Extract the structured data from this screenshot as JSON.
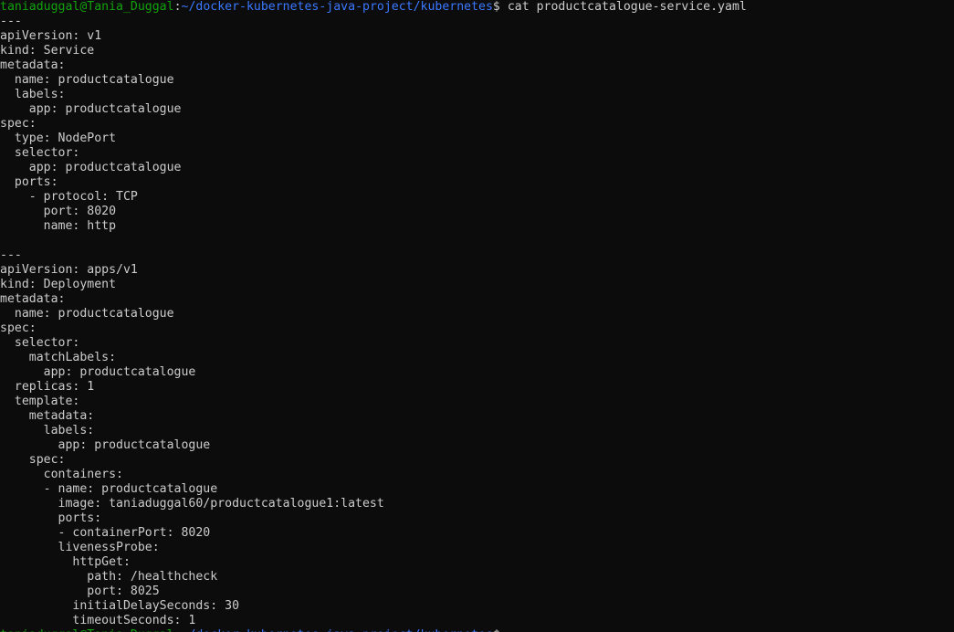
{
  "prompt": {
    "user_host": "taniaduggal@Tania_Duggal",
    "path": "~/docker-kubernetes-java-project/kubernetes",
    "command": "cat productcatalogue-service.yaml"
  },
  "file_lines": [
    "---",
    "apiVersion: v1",
    "kind: Service",
    "metadata:",
    "  name: productcatalogue",
    "  labels:",
    "    app: productcatalogue",
    "spec:",
    "  type: NodePort",
    "  selector:",
    "    app: productcatalogue",
    "  ports:",
    "    - protocol: TCP",
    "      port: 8020",
    "      name: http",
    "",
    "---",
    "apiVersion: apps/v1",
    "kind: Deployment",
    "metadata:",
    "  name: productcatalogue",
    "spec:",
    "  selector:",
    "    matchLabels:",
    "      app: productcatalogue",
    "  replicas: 1",
    "  template:",
    "    metadata:",
    "      labels:",
    "        app: productcatalogue",
    "    spec:",
    "      containers:",
    "      - name: productcatalogue",
    "        image: taniaduggal60/productcatalogue1:latest",
    "        ports:",
    "        - containerPort: 8020",
    "        livenessProbe:",
    "          httpGet:",
    "            path: /healthcheck",
    "            port: 8025",
    "          initialDelaySeconds: 30",
    "          timeoutSeconds: 1"
  ],
  "colors": {
    "background": "#0c0c0c",
    "text": "#cccccc",
    "user_host": "#13a10e",
    "path": "#3b78ff"
  }
}
